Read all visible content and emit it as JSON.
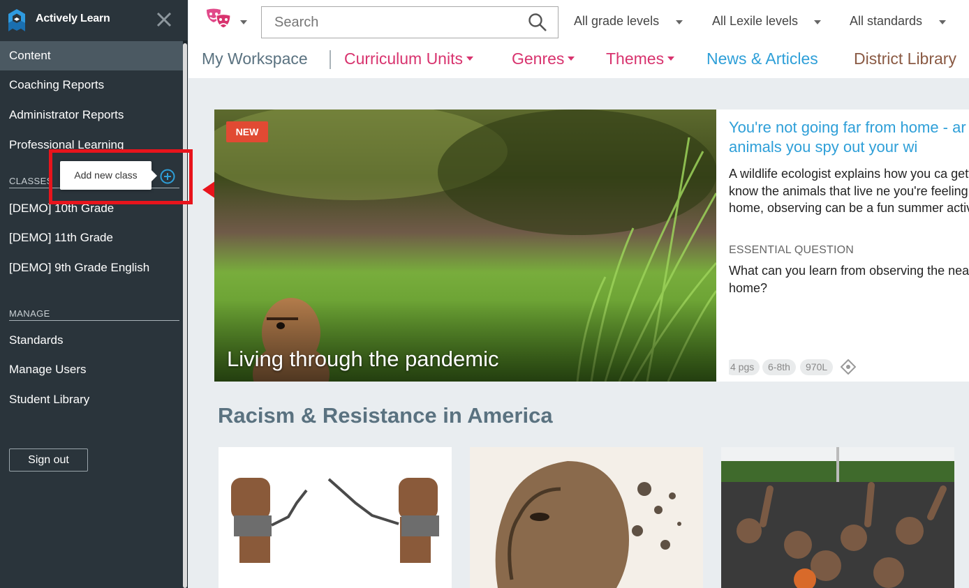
{
  "sidebar": {
    "brand": "Actively Learn",
    "nav": [
      "Content",
      "Coaching Reports",
      "Administrator Reports",
      "Professional Learning"
    ],
    "classes_label": "CLASSES",
    "classes": [
      "[DEMO] 10th Grade",
      "[DEMO] 11th Grade",
      "[DEMO] 9th Grade English"
    ],
    "manage_label": "MANAGE",
    "manage": [
      "Standards",
      "Manage Users",
      "Student Library"
    ],
    "signout": "Sign out",
    "tooltip": "Add new class"
  },
  "topbar": {
    "search_placeholder": "Search",
    "filters": [
      "All grade levels",
      "All Lexile levels",
      "All standards"
    ],
    "tabs": [
      "My Workspace",
      "Curriculum Units",
      "Genres",
      "Themes",
      "News & Articles",
      "District Library"
    ]
  },
  "featured": {
    "badge": "NEW",
    "caption": "Living through the pandemic",
    "title": "You're not going far from home - ar are the animals you spy out your wi",
    "description": "A wildlife ecologist explains how you ca getting to know the animals that live ne you're feeling stuck at home, observing can be a fun summer activity.",
    "eq_label": "ESSENTIAL QUESTION",
    "eq": "What can you learn from observing the near your home?",
    "pills": [
      "4 pgs",
      "6-8th",
      "970L"
    ]
  },
  "section": {
    "title": "Racism & Resistance in America"
  },
  "colors": {
    "sidebar": "#2a343b",
    "active": "#4b5962",
    "accent_pink": "#d8336e",
    "accent_blue": "#2e9fd8",
    "accent_brown": "#8a5a44",
    "highlight_red": "#e8141c"
  }
}
